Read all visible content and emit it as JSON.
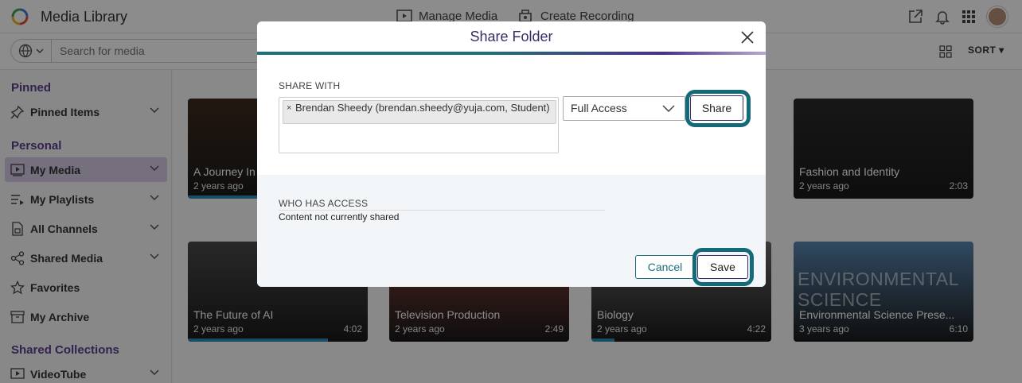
{
  "header": {
    "app_title": "Media Library",
    "nav": [
      {
        "label": "Manage Media",
        "icon": "manage-media-icon"
      },
      {
        "label": "Create Recording",
        "icon": "create-recording-icon"
      }
    ],
    "icons": [
      "external-link-icon",
      "bell-icon",
      "apps-grid-icon",
      "user-avatar"
    ]
  },
  "search": {
    "placeholder": "Search for media",
    "scope_icon": "globe-icon"
  },
  "toolbar": {
    "view_icon": "grid-view-icon",
    "sort_label": "SORT"
  },
  "sidebar": {
    "sections": [
      {
        "heading": "Pinned",
        "items": [
          {
            "label": "Pinned Items",
            "icon": "pin-icon"
          }
        ]
      },
      {
        "heading": "Personal",
        "items": [
          {
            "label": "My Media",
            "icon": "media-icon",
            "active": true
          },
          {
            "label": "My Playlists",
            "icon": "playlist-icon"
          },
          {
            "label": "All Channels",
            "icon": "channels-icon"
          },
          {
            "label": "Shared Media",
            "icon": "share-icon"
          },
          {
            "label": "Favorites",
            "icon": "star-icon"
          },
          {
            "label": "My Archive",
            "icon": "archive-icon"
          }
        ]
      },
      {
        "heading": "Shared Collections",
        "items": [
          {
            "label": "VideoTube",
            "icon": "video-icon"
          }
        ]
      }
    ]
  },
  "media_cards": [
    {
      "title": "A Journey In",
      "date": "2 years ago",
      "duration": "",
      "progress": 0.6,
      "color": "#3d2a1e"
    },
    {
      "title": "Fashion and Identity",
      "date": "2 years ago",
      "duration": "2:03",
      "progress": 0,
      "color": "#2a2a2a"
    },
    {
      "title": "The Future of AI",
      "date": "2 years ago",
      "duration": "4:02",
      "progress": 0.78,
      "color": "#4a4a4a"
    },
    {
      "title": "Television Production",
      "date": "2 years ago",
      "duration": "2:49",
      "progress": 0,
      "color": "#8a3f3a"
    },
    {
      "title": "Biology",
      "date": "2 years ago",
      "duration": "4:22",
      "progress": 0.13,
      "color": "#6a6a68"
    },
    {
      "title": "Environmental Science Prese...",
      "date": "3 years ago",
      "duration": "6:10",
      "progress": 0,
      "color": "#5a86b0",
      "overlay_text": "ENVIRONMENTAL SCIENCE"
    }
  ],
  "modal": {
    "title": "Share Folder",
    "share_with_label": "SHARE WITH",
    "recipient_chip": "Brendan Sheedy (brendan.sheedy@yuja.com, Student)",
    "chip_remove": "×",
    "access_level": "Full Access",
    "share_button": "Share",
    "who_has_access_label": "WHO HAS ACCESS",
    "access_status": "Content not currently shared",
    "cancel_button": "Cancel",
    "save_button": "Save",
    "highlight_color": "#156a7a"
  }
}
